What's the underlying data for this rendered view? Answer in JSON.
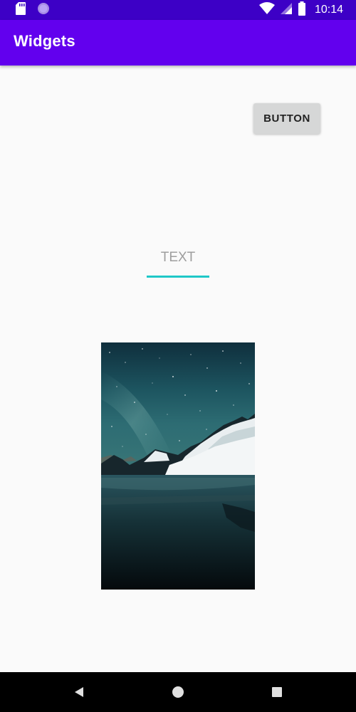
{
  "status_bar": {
    "time": "10:14",
    "icons": [
      "sd-card-icon",
      "circle-notification-icon",
      "wifi-icon",
      "cell-signal-icon",
      "battery-icon"
    ],
    "background": "#3d00c6"
  },
  "app_bar": {
    "title": "Widgets",
    "background": "#6200ee"
  },
  "main": {
    "button_label": "BUTTON",
    "text_field": {
      "value": "",
      "placeholder": "TEXT",
      "underline_color": "#1fc8c8"
    },
    "image": {
      "subject": "night-sky-mountain-lake-photo"
    }
  },
  "nav_bar": {
    "buttons": [
      "back-icon",
      "home-icon",
      "recents-icon"
    ]
  }
}
